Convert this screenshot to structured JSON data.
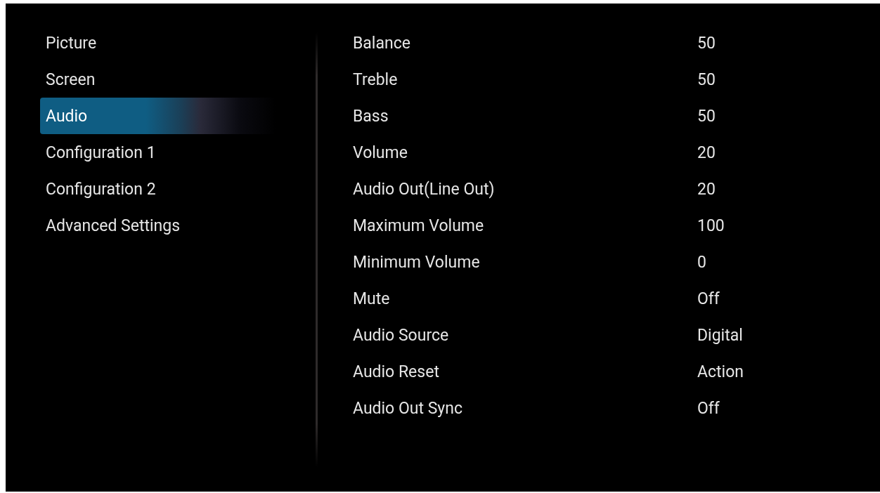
{
  "sidebar": {
    "items": [
      {
        "label": "Picture",
        "selected": false
      },
      {
        "label": "Screen",
        "selected": false
      },
      {
        "label": "Audio",
        "selected": true
      },
      {
        "label": "Configuration 1",
        "selected": false
      },
      {
        "label": "Configuration 2",
        "selected": false
      },
      {
        "label": "Advanced Settings",
        "selected": false
      }
    ]
  },
  "settings": [
    {
      "label": "Balance",
      "value": "50"
    },
    {
      "label": "Treble",
      "value": "50"
    },
    {
      "label": "Bass",
      "value": "50"
    },
    {
      "label": "Volume",
      "value": "20"
    },
    {
      "label": "Audio Out(Line Out)",
      "value": "20"
    },
    {
      "label": "Maximum Volume",
      "value": "100"
    },
    {
      "label": "Minimum Volume",
      "value": "0"
    },
    {
      "label": "Mute",
      "value": "Off"
    },
    {
      "label": "Audio Source",
      "value": "Digital"
    },
    {
      "label": "Audio Reset",
      "value": "Action"
    },
    {
      "label": "Audio Out Sync",
      "value": "Off"
    }
  ]
}
